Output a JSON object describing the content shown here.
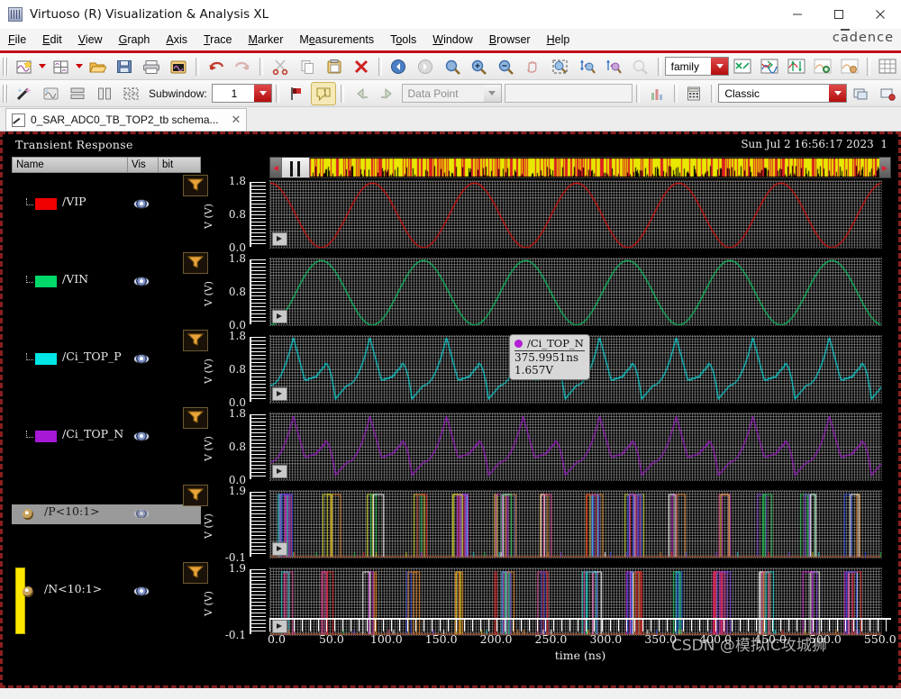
{
  "window": {
    "title": "Virtuoso (R) Visualization & Analysis XL",
    "minimize": "—",
    "maximize": "☐",
    "close": "✕",
    "brand": "cadence"
  },
  "menubar": {
    "items": [
      {
        "label": "File",
        "accel": "F"
      },
      {
        "label": "Edit",
        "accel": "E"
      },
      {
        "label": "View",
        "accel": "V"
      },
      {
        "label": "Graph",
        "accel": "G"
      },
      {
        "label": "Axis",
        "accel": "A"
      },
      {
        "label": "Trace",
        "accel": "T"
      },
      {
        "label": "Marker",
        "accel": "M"
      },
      {
        "label": "Measurements",
        "accel": "e"
      },
      {
        "label": "Tools",
        "accel": "o"
      },
      {
        "label": "Window",
        "accel": "W"
      },
      {
        "label": "Browser",
        "accel": "B"
      },
      {
        "label": "Help",
        "accel": "H"
      }
    ]
  },
  "toolbar": {
    "family_combo_value": "family",
    "subwindow_label": "Subwindow:",
    "subwindow_value": "1",
    "datapoint_value": "Data Point",
    "datapoint_text_value": "",
    "style_combo_value": "Classic"
  },
  "tab": {
    "label": "0_SAR_ADC0_TB_TOP2_tb schema...",
    "close": "✕"
  },
  "graph": {
    "title": "Transient Response",
    "date": "Sun Jul 2 16:56:17 2023",
    "date_suffix": "1",
    "legend_headers": [
      "Name",
      "Vis",
      "bit"
    ],
    "watermark": "CSDN @模拟IC攻城狮"
  },
  "signals": [
    {
      "name": "/VIP",
      "color": "#f00000",
      "type": "analog",
      "selected": false
    },
    {
      "name": "/VIN",
      "color": "#00d96a",
      "type": "analog",
      "selected": false
    },
    {
      "name": "/Ci_TOP_P",
      "color": "#00e5e5",
      "type": "analog",
      "selected": false
    },
    {
      "name": "/Ci_TOP_N",
      "color": "#a617d6",
      "type": "analog",
      "selected": false
    },
    {
      "name": "/P<10:1>",
      "color": "#bfbfbf",
      "type": "bus",
      "selected": true
    },
    {
      "name": "/N<10:1>",
      "color": "#ffe800",
      "type": "bus",
      "selected": false
    }
  ],
  "marker": {
    "signal": "/Ci_TOP_N",
    "time": "375.9951ns",
    "value": "1.657V",
    "color": "#b21fd6"
  },
  "chart_data": {
    "type": "line",
    "title": "Transient Response",
    "xlabel": "time (ns)",
    "xlim": [
      0,
      550
    ],
    "xticks": [
      "0.0",
      "50.0",
      "100.0",
      "150.0",
      "200.0",
      "250.0",
      "300.0",
      "350.0",
      "400.0",
      "450.0",
      "500.0",
      "550.0"
    ],
    "panes": [
      {
        "signal": "/VIP",
        "ylabel": "V (V)",
        "ylim": [
          0.0,
          1.8
        ],
        "yticks": [
          "1.8",
          "0.8",
          "0.0"
        ],
        "color": "#f00000",
        "shape": "sine",
        "cycles": 6,
        "phase": 0.25
      },
      {
        "signal": "/VIN",
        "ylabel": "V (V)",
        "ylim": [
          0.0,
          1.8
        ],
        "yticks": [
          "1.8",
          "0.8",
          "0.0"
        ],
        "color": "#00d96a",
        "shape": "sine",
        "cycles": 6,
        "phase": 0.75
      },
      {
        "signal": "/Ci_TOP_P",
        "ylabel": "V (V)",
        "ylim": [
          0.0,
          1.8
        ],
        "yticks": [
          "1.8",
          "0.8",
          "0.0"
        ],
        "color": "#00e5e5",
        "shape": "sar-dac",
        "cycles": 8,
        "phase": 0.0
      },
      {
        "signal": "/Ci_TOP_N",
        "ylabel": "V (V)",
        "ylim": [
          0.0,
          1.8
        ],
        "yticks": [
          "1.8",
          "0.8",
          "0.0"
        ],
        "color": "#a617d6",
        "shape": "sar-dac",
        "cycles": 8,
        "phase": 0.0
      },
      {
        "signal": "/P<10:1>",
        "ylabel": "V (V)",
        "ylim": [
          -0.1,
          1.9
        ],
        "yticks": [
          "1.9",
          "-0.1"
        ],
        "color": "#bfbfbf",
        "shape": "bus",
        "groups": 14
      },
      {
        "signal": "/N<10:1>",
        "ylabel": "V (V)",
        "ylim": [
          -0.1,
          1.9
        ],
        "yticks": [
          "1.9",
          "-0.1"
        ],
        "color": "#ffe800",
        "shape": "bus",
        "groups": 14
      }
    ],
    "bus_colors": [
      "#e02020",
      "#2040e0",
      "#20c050",
      "#d0d020",
      "#d020d0",
      "#e08020",
      "#20d0d0",
      "#ffffff",
      "#8040e0",
      "#e04090"
    ]
  }
}
